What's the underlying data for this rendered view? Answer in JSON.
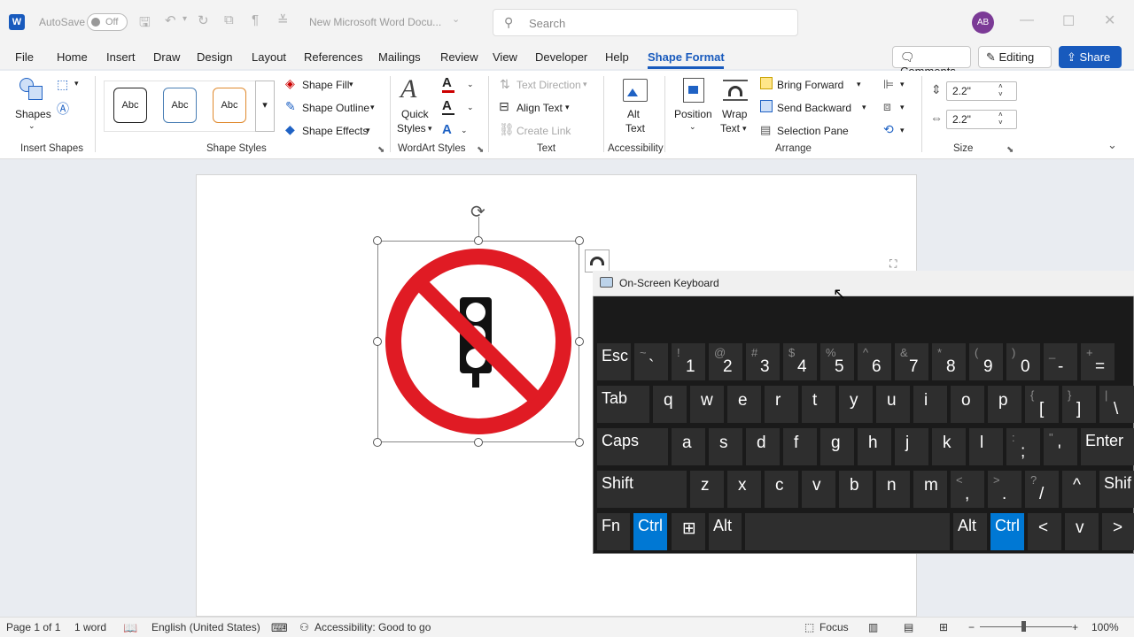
{
  "titlebar": {
    "logo": "W",
    "autosave_label": "AutoSave",
    "autosave_state": "Off",
    "doc_title": "New Microsoft Word Docu...",
    "search_placeholder": "Search",
    "avatar": "AB"
  },
  "menu": {
    "tabs": [
      "File",
      "Home",
      "Insert",
      "Draw",
      "Design",
      "Layout",
      "References",
      "Mailings",
      "Review",
      "View",
      "Developer",
      "Help",
      "Shape Format"
    ],
    "active": "Shape Format",
    "comments": "Comments",
    "editing": "Editing",
    "share": "Share"
  },
  "ribbon": {
    "shapes": "Shapes",
    "style_sample": "Abc",
    "shape_fill": "Shape Fill",
    "shape_outline": "Shape Outline",
    "shape_effects": "Shape Effects",
    "quick_styles_1": "Quick",
    "quick_styles_2": "Styles",
    "text_direction": "Text Direction",
    "align_text": "Align Text",
    "create_link": "Create Link",
    "alt_text_1": "Alt",
    "alt_text_2": "Text",
    "position": "Position",
    "wrap_text_1": "Wrap",
    "wrap_text_2": "Text",
    "bring_forward": "Bring Forward",
    "send_backward": "Send Backward",
    "selection_pane": "Selection Pane",
    "height": "2.2\"",
    "width": "2.2\"",
    "groups": {
      "insert_shapes": "Insert Shapes",
      "shape_styles": "Shape Styles",
      "wordart_styles": "WordArt Styles",
      "text": "Text",
      "accessibility": "Accessibility",
      "arrange": "Arrange",
      "size": "Size"
    }
  },
  "osk": {
    "title": "On-Screen Keyboard",
    "row1": [
      {
        "main": "Esc",
        "shift": ""
      },
      {
        "main": "`",
        "shift": "~"
      },
      {
        "main": "1",
        "shift": "!"
      },
      {
        "main": "2",
        "shift": "@"
      },
      {
        "main": "3",
        "shift": "#"
      },
      {
        "main": "4",
        "shift": "$"
      },
      {
        "main": "5",
        "shift": "%"
      },
      {
        "main": "6",
        "shift": "^"
      },
      {
        "main": "7",
        "shift": "&"
      },
      {
        "main": "8",
        "shift": "*"
      },
      {
        "main": "9",
        "shift": "("
      },
      {
        "main": "0",
        "shift": ")"
      },
      {
        "main": "-",
        "shift": "_"
      },
      {
        "main": "=",
        "shift": "+"
      }
    ],
    "row2": [
      {
        "main": "Tab",
        "shift": ""
      },
      {
        "main": "q"
      },
      {
        "main": "w"
      },
      {
        "main": "e"
      },
      {
        "main": "r"
      },
      {
        "main": "t"
      },
      {
        "main": "y"
      },
      {
        "main": "u"
      },
      {
        "main": "i"
      },
      {
        "main": "o"
      },
      {
        "main": "p"
      },
      {
        "main": "[",
        "shift": "{"
      },
      {
        "main": "]",
        "shift": "}"
      },
      {
        "main": "\\",
        "shift": "|"
      }
    ],
    "row3": [
      {
        "main": "Caps"
      },
      {
        "main": "a"
      },
      {
        "main": "s"
      },
      {
        "main": "d"
      },
      {
        "main": "f"
      },
      {
        "main": "g"
      },
      {
        "main": "h"
      },
      {
        "main": "j"
      },
      {
        "main": "k"
      },
      {
        "main": "l"
      },
      {
        "main": ";",
        "shift": ":"
      },
      {
        "main": "'",
        "shift": "\""
      },
      {
        "main": "Enter"
      }
    ],
    "row4": [
      {
        "main": "Shift"
      },
      {
        "main": "z"
      },
      {
        "main": "x"
      },
      {
        "main": "c"
      },
      {
        "main": "v"
      },
      {
        "main": "b"
      },
      {
        "main": "n"
      },
      {
        "main": "m"
      },
      {
        "main": ",",
        "shift": "<"
      },
      {
        "main": ".",
        "shift": ">"
      },
      {
        "main": "/",
        "shift": "?"
      },
      {
        "main": "^"
      },
      {
        "main": "Shif"
      }
    ],
    "row5": [
      {
        "main": "Fn"
      },
      {
        "main": "Ctrl"
      },
      {
        "main": "⊞"
      },
      {
        "main": "Alt"
      },
      {
        "main": ""
      },
      {
        "main": "Alt"
      },
      {
        "main": "Ctrl"
      },
      {
        "main": "<"
      },
      {
        "main": "v"
      },
      {
        "main": ">"
      }
    ]
  },
  "statusbar": {
    "page": "Page 1 of 1",
    "words": "1 word",
    "language": "English (United States)",
    "accessibility": "Accessibility: Good to go",
    "focus": "Focus",
    "zoom": "100%"
  },
  "colors": {
    "accent": "#185abd",
    "sign_red": "#e01b24",
    "osk_key": "#2e2e2e",
    "osk_active": "#0078d4"
  }
}
